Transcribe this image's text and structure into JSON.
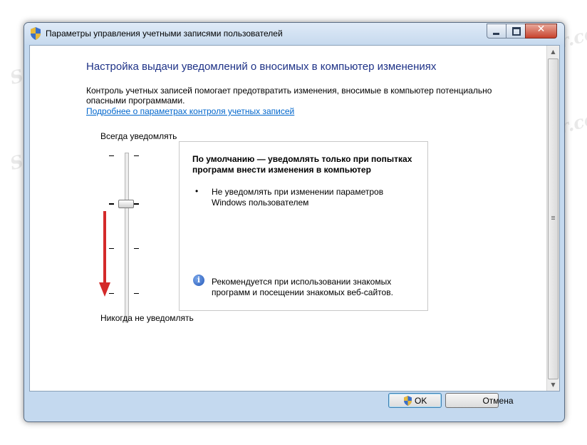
{
  "window": {
    "title": "Параметры управления учетными записями пользователей",
    "close_glyph": "✕"
  },
  "main": {
    "heading": "Настройка выдачи уведомлений о вносимых в компьютер изменениях",
    "description": "Контроль учетных записей помогает предотвратить изменения, вносимые в компьютер потенциально опасными программами.",
    "link": "Подробнее о параметрах контроля учетных записей"
  },
  "slider": {
    "top_label": "Всегда уведомлять",
    "bottom_label": "Никогда не уведомлять",
    "levels": 4,
    "selected_level": 2
  },
  "info": {
    "title": "По умолчанию — уведомлять только при попытках программ внести изменения в компьютер",
    "bullet": "•",
    "bullet_text": "Не уведомлять при изменении параметров Windows пользователем",
    "info_glyph": "i",
    "recommendation": "Рекомендуется при использовании знакомых программ и посещении знакомых веб-сайтов."
  },
  "buttons": {
    "ok": "OK",
    "cancel": "Отмена"
  },
  "watermark": "Soringpcrepair.com",
  "colors": {
    "heading": "#1e3287",
    "link": "#0066cc",
    "arrow": "#d42a2a"
  },
  "icons": {
    "title": "uac-shield-icon",
    "ok": "uac-shield-icon",
    "info": "info-icon",
    "arrow": "arrow-down-icon"
  }
}
